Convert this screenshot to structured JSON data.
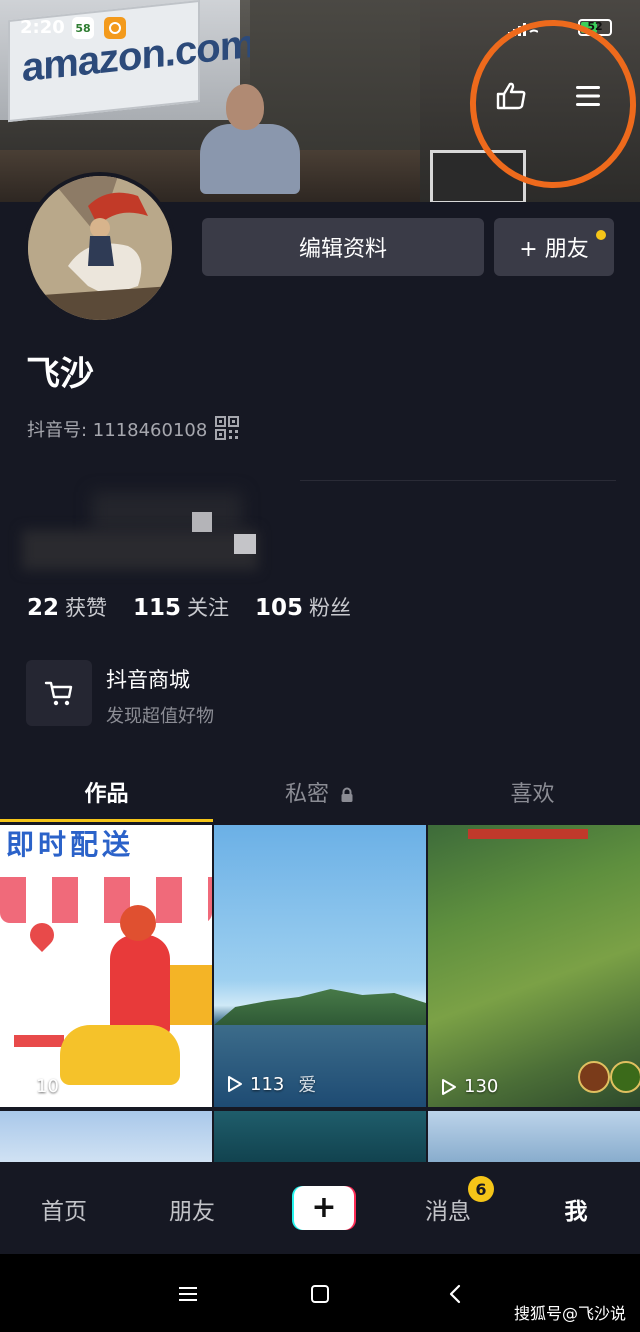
{
  "status_bar": {
    "time": "2:20",
    "badge_58": "58",
    "badge_app": "app",
    "battery": "52"
  },
  "cover": {
    "sign_text": "amazon.com"
  },
  "profile": {
    "edit_label": "编辑资料",
    "friend_label": "+ 朋友",
    "username": "飞沙",
    "douyin_id": "抖音号: 1118460108"
  },
  "stats": [
    {
      "num": "22",
      "label": "获赞"
    },
    {
      "num": "115",
      "label": "关注"
    },
    {
      "num": "105",
      "label": "粉丝"
    }
  ],
  "shop": {
    "title": "抖音商城",
    "subtitle": "发现超值好物"
  },
  "tabs": {
    "works": "作品",
    "private": "私密",
    "likes": "喜欢"
  },
  "videos": [
    {
      "banner": "即时配送",
      "plays": "10"
    },
    {
      "plays": "113",
      "extra": "爱"
    },
    {
      "plays": "130"
    }
  ],
  "nav": {
    "home": "首页",
    "friends": "朋友",
    "messages": "消息",
    "messages_badge": "6",
    "me": "我"
  },
  "watermark": "搜狐号@飞沙说",
  "colors": {
    "background": "#161823",
    "accent_yellow": "#f5c518",
    "highlight_orange": "#ee6a1c"
  }
}
